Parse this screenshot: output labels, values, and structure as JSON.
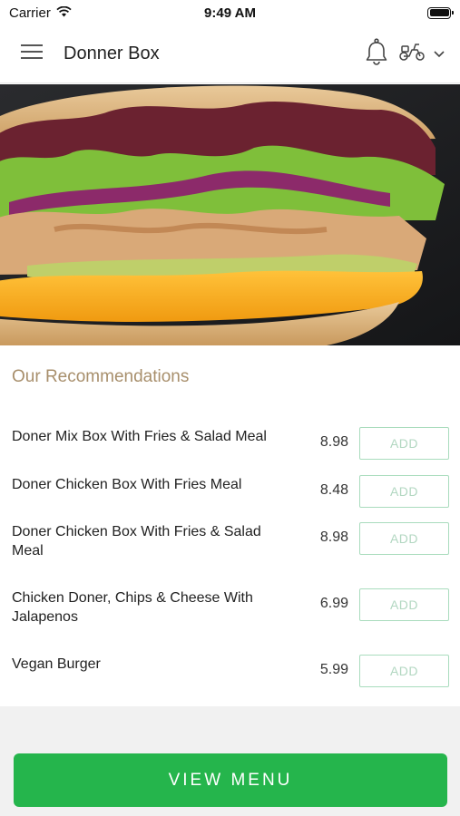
{
  "status_bar": {
    "carrier": "Carrier",
    "time": "9:49 AM"
  },
  "header": {
    "title": "Donner Box",
    "icons": [
      "menu-icon",
      "bell-icon",
      "scooter-icon",
      "chevron-down-icon"
    ]
  },
  "hero": {
    "image": "doner-sandwich-photo"
  },
  "recommendations": {
    "title": "Our Recommendations",
    "items": [
      {
        "name": "Doner Mix Box With Fries & Salad Meal",
        "price": "8.98",
        "add_label": "ADD"
      },
      {
        "name": "Doner Chicken Box With Fries Meal",
        "price": "8.48",
        "add_label": "ADD"
      },
      {
        "name": "Doner Chicken Box With Fries & Salad Meal",
        "price": "8.98",
        "add_label": "ADD"
      },
      {
        "name": "Chicken Doner, Chips & Cheese With Jalapenos",
        "price": "6.99",
        "add_label": "ADD"
      },
      {
        "name": "Vegan Burger",
        "price": "5.99",
        "add_label": "ADD"
      }
    ]
  },
  "footer": {
    "view_menu_label": "VIEW MENU"
  },
  "colors": {
    "accent_green": "#25b54c",
    "section_title": "#a88f6c",
    "add_border": "#a9dcbd"
  }
}
